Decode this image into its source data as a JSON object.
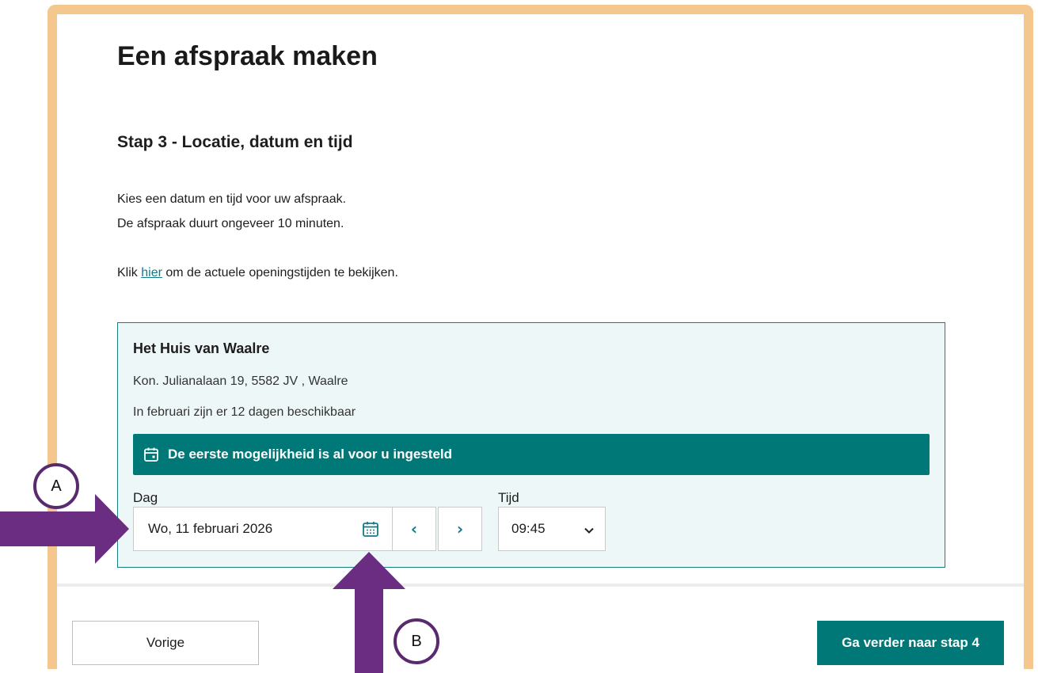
{
  "page": {
    "title": "Een afspraak maken",
    "step_title": "Stap 3 - Locatie, datum en tijd",
    "intro_line1": "Kies een datum en tijd voor uw afspraak.",
    "intro_line2": "De afspraak duurt ongeveer 10 minuten.",
    "hours_prefix": "Klik ",
    "hours_link": "hier",
    "hours_suffix": " om de actuele openingstijden te bekijken."
  },
  "location": {
    "name": "Het Huis van Waalre",
    "address": "Kon. Julianalaan 19, 5582 JV , Waalre",
    "availability": "In februari zijn er 12 dagen beschikbaar",
    "banner": "De eerste mogelijkheid is al voor u ingesteld"
  },
  "picker": {
    "day_label": "Dag",
    "day_value": "Wo, 11 februari 2026",
    "prev_icon": "‹",
    "next_icon": "›",
    "time_label": "Tijd",
    "time_value": "09:45"
  },
  "footer": {
    "prev_label": "Vorige",
    "next_label": "Ga verder naar stap 4"
  },
  "annotations": {
    "a_label": "A",
    "b_label": "B",
    "arrow_color": "#6b2d82"
  },
  "colors": {
    "accent": "#007877",
    "panel_bg": "#eef7f7",
    "frame": "#f4c78f",
    "link": "#137a8a"
  }
}
